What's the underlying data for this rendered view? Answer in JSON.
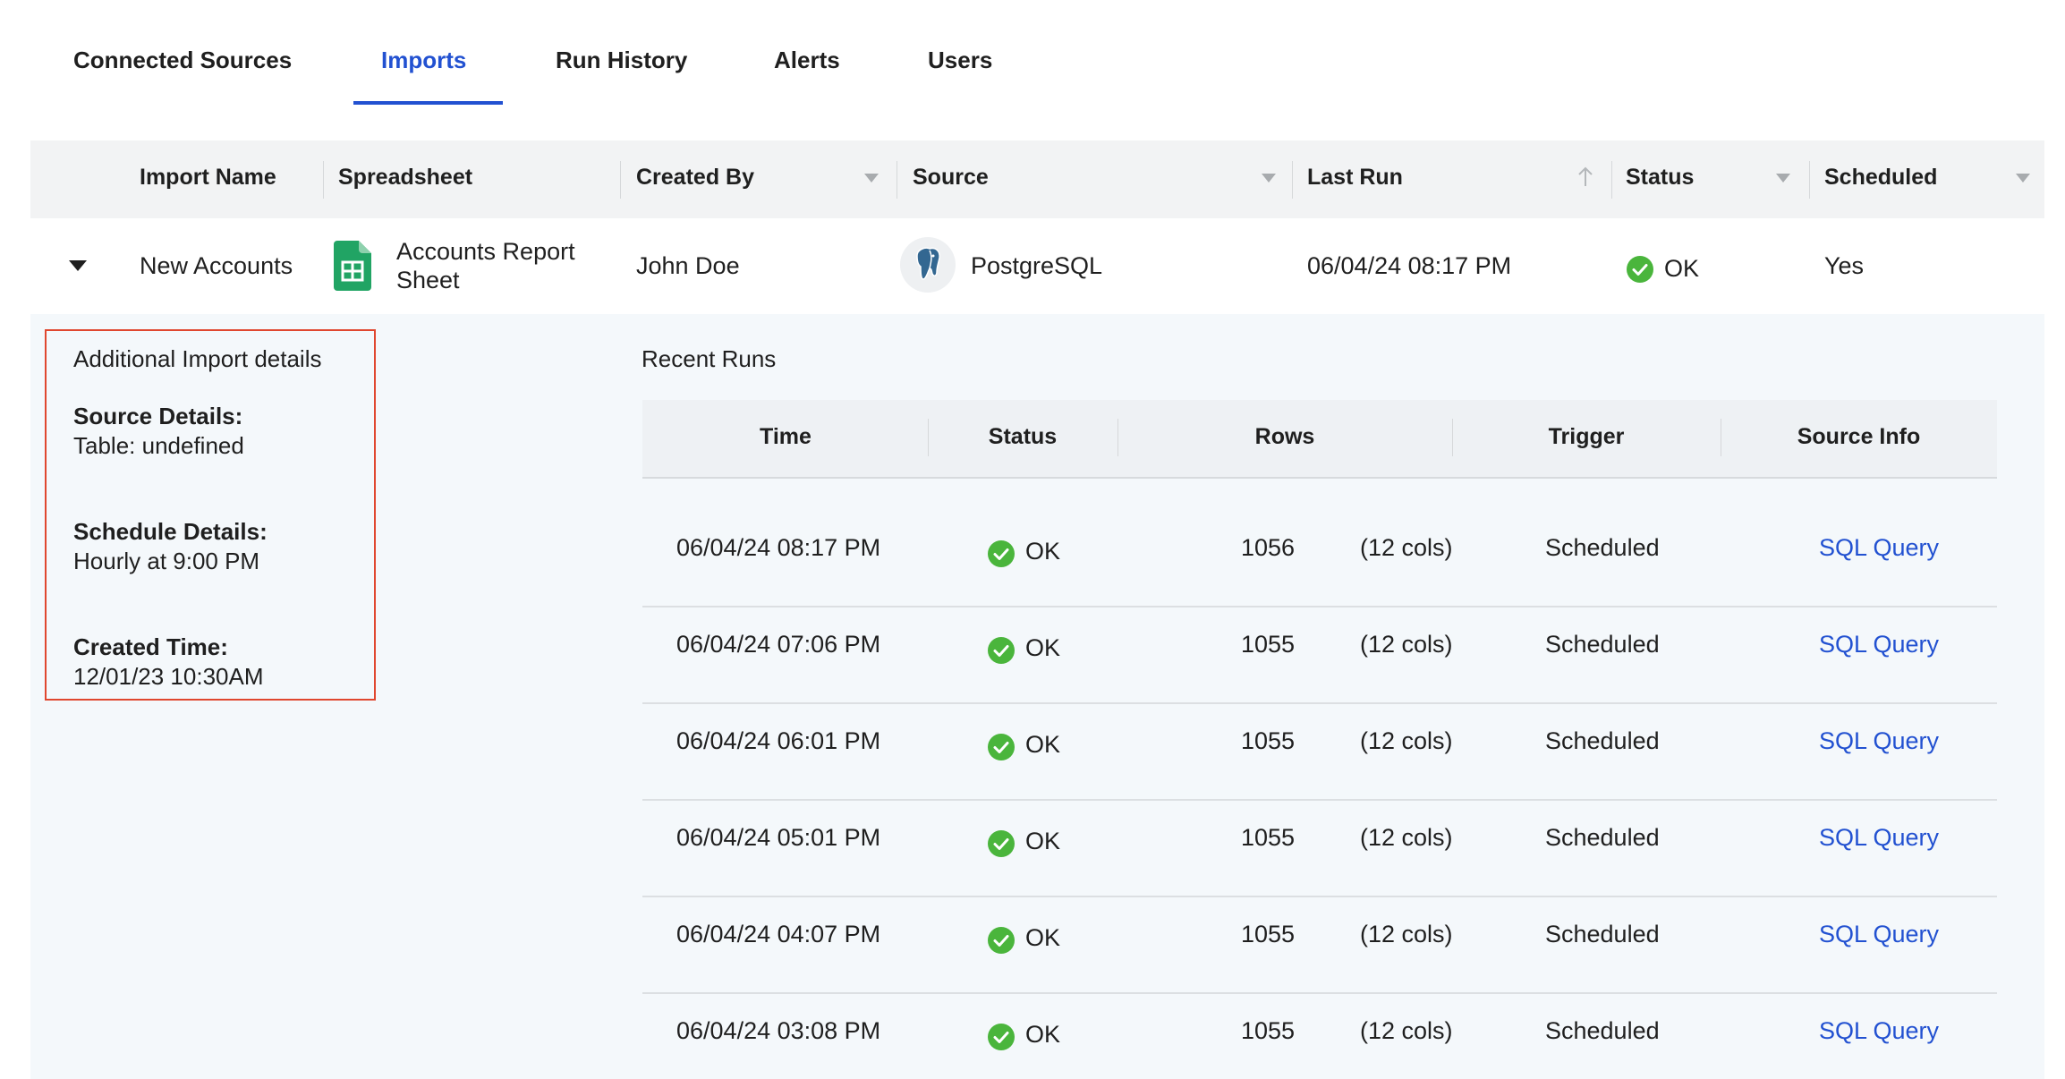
{
  "tabs": [
    {
      "label": "Connected Sources"
    },
    {
      "label": "Imports"
    },
    {
      "label": "Run History"
    },
    {
      "label": "Alerts"
    },
    {
      "label": "Users"
    }
  ],
  "active_tab": "Imports",
  "table": {
    "columns": [
      "Import Name",
      "Spreadsheet",
      "Created By",
      "Source",
      "Last Run",
      "Status",
      "Scheduled"
    ],
    "row": {
      "import_name": "New Accounts",
      "spreadsheet_line1": "Accounts Report",
      "spreadsheet_line2": "Sheet",
      "created_by": "John Doe",
      "source": "PostgreSQL",
      "last_run": "06/04/24 08:17 PM",
      "status": "OK",
      "scheduled": "Yes"
    }
  },
  "details": {
    "title": "Additional Import details",
    "source_label": "Source Details:",
    "source_value": "Table: undefined",
    "schedule_label": "Schedule Details:",
    "schedule_value": "Hourly at 9:00 PM",
    "created_label": "Created Time:",
    "created_value": "12/01/23 10:30AM"
  },
  "recent_runs": {
    "title": "Recent Runs",
    "columns": [
      "Time",
      "Status",
      "Rows",
      "Trigger",
      "Source Info"
    ],
    "rows": [
      {
        "time": "06/04/24 08:17 PM",
        "status": "OK",
        "rows": "1056",
        "cols": "(12 cols)",
        "trigger": "Scheduled",
        "source_info": "SQL Query"
      },
      {
        "time": "06/04/24 07:06 PM",
        "status": "OK",
        "rows": "1055",
        "cols": "(12 cols)",
        "trigger": "Scheduled",
        "source_info": "SQL Query"
      },
      {
        "time": "06/04/24 06:01 PM",
        "status": "OK",
        "rows": "1055",
        "cols": "(12 cols)",
        "trigger": "Scheduled",
        "source_info": "SQL Query"
      },
      {
        "time": "06/04/24 05:01 PM",
        "status": "OK",
        "rows": "1055",
        "cols": "(12 cols)",
        "trigger": "Scheduled",
        "source_info": "SQL Query"
      },
      {
        "time": "06/04/24 04:07 PM",
        "status": "OK",
        "rows": "1055",
        "cols": "(12 cols)",
        "trigger": "Scheduled",
        "source_info": "SQL Query"
      },
      {
        "time": "06/04/24 03:08 PM",
        "status": "OK",
        "rows": "1055",
        "cols": "(12 cols)",
        "trigger": "Scheduled",
        "source_info": "SQL Query"
      }
    ]
  },
  "icons": {
    "expand": "caret-down-icon",
    "spreadsheet": "google-sheets-icon",
    "source": "postgresql-elephant-icon",
    "ok": "check-circle-icon",
    "sort": "arrow-up-icon",
    "filter": "chevron-down-icon"
  },
  "colors": {
    "accent": "#2251d1",
    "ok_green": "#4ab53c",
    "highlight_border": "#e0472f",
    "sheets_green": "#21a464"
  }
}
